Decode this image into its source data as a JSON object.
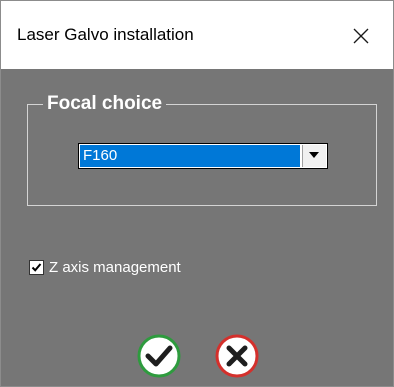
{
  "window": {
    "title": "Laser Galvo installation",
    "close_icon": "close-icon"
  },
  "focal": {
    "group_label": "Focal choice",
    "selected": "F160",
    "dropdown_icon": "chevron-down-icon"
  },
  "z_axis": {
    "label": "Z axis management",
    "checked": true
  },
  "actions": {
    "ok_icon": "check-circle-icon",
    "cancel_icon": "x-circle-icon"
  },
  "colors": {
    "dialog_bg": "#767676",
    "selection": "#0078d7",
    "ok_green": "#2e9b3e",
    "cancel_red": "#d4302c"
  }
}
